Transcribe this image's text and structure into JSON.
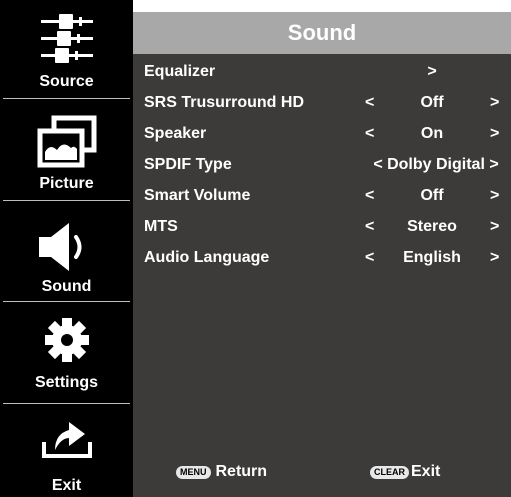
{
  "sidebar": {
    "items": [
      {
        "label": "Source",
        "icon": "source-cables-icon"
      },
      {
        "label": "Picture",
        "icon": "picture-frames-icon"
      },
      {
        "label": "Sound",
        "icon": "speaker-icon"
      },
      {
        "label": "Settings",
        "icon": "gear-icon"
      },
      {
        "label": "Exit",
        "icon": "exit-arrow-icon"
      }
    ]
  },
  "panel": {
    "title": "Sound",
    "rows": [
      {
        "name": "Equalizer",
        "value": ">",
        "left": "",
        "right": ""
      },
      {
        "name": "SRS Trusurround HD",
        "value": "Off",
        "left": "<",
        "right": ">"
      },
      {
        "name": "Speaker",
        "value": "On",
        "left": "<",
        "right": ">"
      },
      {
        "name": "SPDIF Type",
        "value": "< Dolby Digital >",
        "left": "",
        "right": ""
      },
      {
        "name": "Smart Volume",
        "value": "Off",
        "left": "<",
        "right": ">"
      },
      {
        "name": "MTS",
        "value": "Stereo",
        "left": "<",
        "right": ">"
      },
      {
        "name": "Audio Language",
        "value": "English",
        "left": "<",
        "right": ">"
      }
    ]
  },
  "footer": {
    "menu_key": "MENU",
    "menu_label": "Return",
    "clear_key": "CLEAR",
    "clear_label": "Exit"
  },
  "colors": {
    "sidebar_bg": "#000000",
    "panel_bg": "#3d3b3a",
    "header_bg": "#a8a8a8",
    "text": "#ffffff"
  }
}
